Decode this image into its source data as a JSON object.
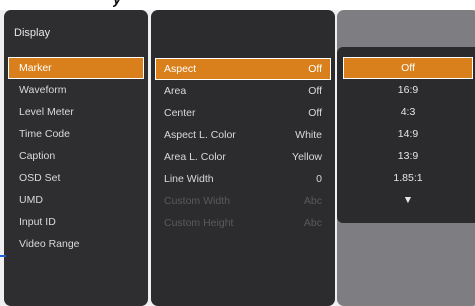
{
  "header": {
    "fragment": "y"
  },
  "main_menu": {
    "title": "Display",
    "items": [
      {
        "label": "Marker",
        "selected": true
      },
      {
        "label": "Waveform"
      },
      {
        "label": "Level Meter"
      },
      {
        "label": "Time Code"
      },
      {
        "label": "Caption"
      },
      {
        "label": "OSD Set"
      },
      {
        "label": "UMD"
      },
      {
        "label": "Input ID"
      },
      {
        "label": "Video Range"
      }
    ]
  },
  "sub_menu": {
    "items": [
      {
        "label": "Aspect",
        "value": "Off",
        "selected": true
      },
      {
        "label": "Area",
        "value": "Off"
      },
      {
        "label": "Center",
        "value": "Off"
      },
      {
        "label": "Aspect L. Color",
        "value": "White"
      },
      {
        "label": "Area L. Color",
        "value": "Yellow"
      },
      {
        "label": "Line Width",
        "value": "0"
      },
      {
        "label": "Custom Width",
        "value": "Abc",
        "disabled": true
      },
      {
        "label": "Custom Height",
        "value": "Abc",
        "disabled": true
      }
    ]
  },
  "options": {
    "items": [
      "Off",
      "16:9",
      "4:3",
      "14:9",
      "13:9",
      "1.85:1",
      "▼"
    ],
    "selected": "Off"
  },
  "colors": {
    "accent": "#d9801c",
    "panel": "#2e2e31",
    "background": "#efefef",
    "blue_marker": "#1e63d8"
  }
}
